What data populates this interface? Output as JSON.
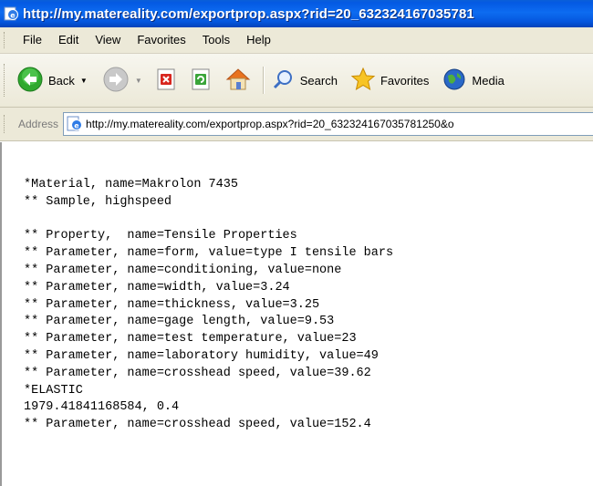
{
  "window": {
    "title": "http://my.matereality.com/exportprop.aspx?rid=20_632324167035781"
  },
  "menu": {
    "items": [
      "File",
      "Edit",
      "View",
      "Favorites",
      "Tools",
      "Help"
    ]
  },
  "toolbar": {
    "back_label": "Back",
    "search_label": "Search",
    "favorites_label": "Favorites",
    "media_label": "Media"
  },
  "address": {
    "label": "Address",
    "value": "http://my.matereality.com/exportprop.aspx?rid=20_632324167035781250&o"
  },
  "content": {
    "lines": [
      "*Material, name=Makrolon 7435",
      "** Sample, highspeed",
      "",
      "** Property,  name=Tensile Properties",
      "** Parameter, name=form, value=type I tensile bars",
      "** Parameter, name=conditioning, value=none",
      "** Parameter, name=width, value=3.24",
      "** Parameter, name=thickness, value=3.25",
      "** Parameter, name=gage length, value=9.53",
      "** Parameter, name=test temperature, value=23",
      "** Parameter, name=laboratory humidity, value=49",
      "** Parameter, name=crosshead speed, value=39.62",
      "*ELASTIC",
      "1979.41841168584, 0.4",
      "** Parameter, name=crosshead speed, value=152.4"
    ]
  }
}
